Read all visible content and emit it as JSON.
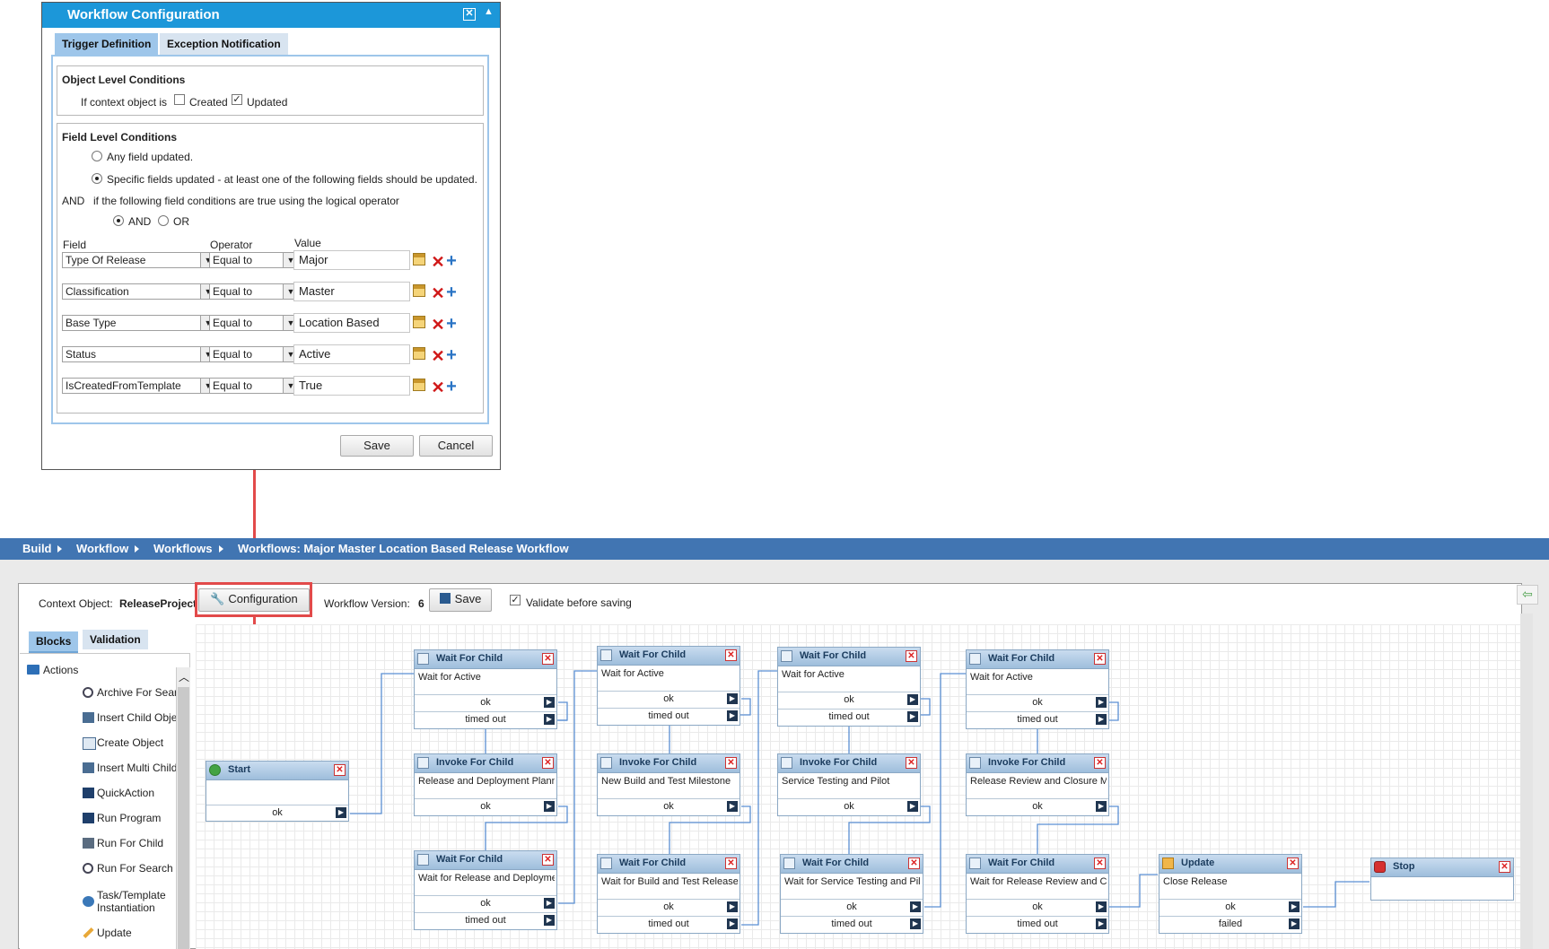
{
  "dialog": {
    "title": "Workflow Configuration",
    "tabs": [
      {
        "label": "Trigger Definition",
        "active": true
      },
      {
        "label": "Exception Notification",
        "active": false
      }
    ],
    "object_level": {
      "title": "Object Level Conditions",
      "prompt": "If context object is",
      "created_label": "Created",
      "created_checked": false,
      "updated_label": "Updated",
      "updated_checked": true
    },
    "field_level": {
      "title": "Field Level Conditions",
      "any_label": "Any field updated.",
      "specific_label": "Specific fields updated - at least one of the following fields should be updated.",
      "selected": "specific",
      "and_prefix": "AND",
      "operator_prompt": "if the following field conditions are true using the logical operator",
      "and_label": "AND",
      "or_label": "OR",
      "logical_operator": "AND",
      "col_field": "Field",
      "col_operator": "Operator",
      "col_value": "Value",
      "rows": [
        {
          "field": "Type Of Release",
          "operator": "Equal to",
          "value": "Major"
        },
        {
          "field": "Classification",
          "operator": "Equal to",
          "value": "Master"
        },
        {
          "field": "Base Type",
          "operator": "Equal to",
          "value": "Location Based"
        },
        {
          "field": "Status",
          "operator": "Equal to",
          "value": "Active"
        },
        {
          "field": "IsCreatedFromTemplate",
          "operator": "Equal to",
          "value": "True"
        }
      ]
    },
    "save_label": "Save",
    "cancel_label": "Cancel"
  },
  "breadcrumb": [
    "Build",
    "Workflow",
    "Workflows",
    "Workflows: Major Master Location Based Release Workflow"
  ],
  "toolbar": {
    "context_label": "Context Object:",
    "context_value": "ReleaseProject",
    "configuration_label": "Configuration",
    "version_label": "Workflow Version:",
    "version_value": "6",
    "save_label": "Save",
    "validate_label": "Validate before saving",
    "validate_checked": true
  },
  "left_tabs": [
    {
      "label": "Blocks",
      "active": true
    },
    {
      "label": "Validation",
      "active": false
    }
  ],
  "palette": {
    "group": "Actions",
    "items": [
      "Archive For Search",
      "Insert Child Object",
      "Create Object",
      "Insert Multi Child",
      "QuickAction",
      "Run Program",
      "Run For Child",
      "Run For Search",
      "Task/Template Instantiation",
      "Update"
    ]
  },
  "blocks": [
    {
      "id": "start",
      "type": "Start",
      "desc": "",
      "outputs": [
        "ok"
      ]
    },
    {
      "id": "w1",
      "type": "Wait For Child",
      "desc": "Wait for Active",
      "outputs": [
        "ok",
        "timed out"
      ]
    },
    {
      "id": "i1",
      "type": "Invoke For Child",
      "desc": "Release and Deployment Planning",
      "outputs": [
        "ok"
      ]
    },
    {
      "id": "w2",
      "type": "Wait For Child",
      "desc": "Wait for Release and Deployment",
      "outputs": [
        "ok",
        "timed out"
      ]
    },
    {
      "id": "w3",
      "type": "Wait For Child",
      "desc": "Wait for Active",
      "outputs": [
        "ok",
        "timed out"
      ]
    },
    {
      "id": "i2",
      "type": "Invoke For Child",
      "desc": "New Build and Test Milestone",
      "outputs": [
        "ok"
      ]
    },
    {
      "id": "w4",
      "type": "Wait For Child",
      "desc": "Wait for Build and Test Release",
      "outputs": [
        "ok",
        "timed out"
      ]
    },
    {
      "id": "w5",
      "type": "Wait For Child",
      "desc": "Wait for Active",
      "outputs": [
        "ok",
        "timed out"
      ]
    },
    {
      "id": "i3",
      "type": "Invoke For Child",
      "desc": "Service Testing and Pilot",
      "outputs": [
        "ok"
      ]
    },
    {
      "id": "w6",
      "type": "Wait For Child",
      "desc": "Wait for Service Testing and Pilot",
      "outputs": [
        "ok",
        "timed out"
      ]
    },
    {
      "id": "w7",
      "type": "Wait For Child",
      "desc": "Wait for Active",
      "outputs": [
        "ok",
        "timed out"
      ]
    },
    {
      "id": "i4",
      "type": "Invoke For Child",
      "desc": "Release Review and Closure Milestone",
      "outputs": [
        "ok"
      ]
    },
    {
      "id": "w8",
      "type": "Wait For Child",
      "desc": "Wait for Release Review and Closure",
      "outputs": [
        "ok",
        "timed out"
      ]
    },
    {
      "id": "upd",
      "type": "Update",
      "desc": "Close Release",
      "outputs": [
        "ok",
        "failed"
      ]
    },
    {
      "id": "stop",
      "type": "Stop",
      "desc": "",
      "outputs": []
    }
  ],
  "colors": {
    "title_bar": "#1c97d9",
    "breadcrumb_bar": "#4175b2",
    "highlight_red": "#e24a4a",
    "block_header": "#9ebedc",
    "wire": "#5b8fd3"
  }
}
